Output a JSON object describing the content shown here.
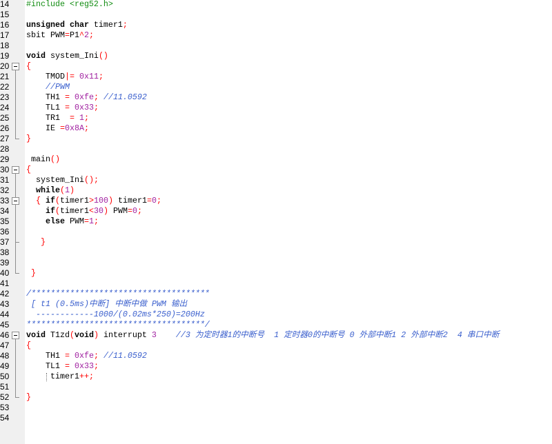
{
  "editor": {
    "syntax_colors": {
      "preprocessor": "#128c12",
      "keyword": "#000000",
      "identifier": "#000000",
      "operator": "#ff0000",
      "number": "#a020a0",
      "comment": "#3a5fcd"
    },
    "lines": [
      {
        "n": 14,
        "tokens": [
          [
            "preprocessor",
            "#include <reg52.h>"
          ]
        ]
      },
      {
        "n": 15,
        "tokens": []
      },
      {
        "n": 16,
        "tokens": [
          [
            "keyword",
            "unsigned char"
          ],
          [
            "identifier",
            " timer1"
          ],
          [
            "operator",
            ";"
          ]
        ]
      },
      {
        "n": 17,
        "tokens": [
          [
            "identifier",
            "sbit PWM"
          ],
          [
            "operator",
            "="
          ],
          [
            "identifier",
            "P1"
          ],
          [
            "operator",
            "^"
          ],
          [
            "number",
            "2"
          ],
          [
            "operator",
            ";"
          ]
        ]
      },
      {
        "n": 18,
        "tokens": []
      },
      {
        "n": 19,
        "tokens": [
          [
            "keyword",
            "void"
          ],
          [
            "identifier",
            " system_Ini"
          ],
          [
            "operator",
            "()"
          ]
        ]
      },
      {
        "n": 20,
        "fold": "fold-collapse-icon",
        "tokens": [
          [
            "operator",
            "{"
          ]
        ]
      },
      {
        "n": 21,
        "fold": "fold-guide-line",
        "tokens": [
          [
            "identifier",
            "    TMOD"
          ],
          [
            "operator",
            "|="
          ],
          [
            "number",
            " 0x11"
          ],
          [
            "operator",
            ";"
          ]
        ]
      },
      {
        "n": 22,
        "fold": "fold-guide-line",
        "tokens": [
          [
            "comment",
            "    //PWM"
          ]
        ]
      },
      {
        "n": 23,
        "fold": "fold-guide-line",
        "tokens": [
          [
            "identifier",
            "    TH1 "
          ],
          [
            "operator",
            "="
          ],
          [
            "number",
            " 0xfe"
          ],
          [
            "operator",
            ";"
          ],
          [
            "comment",
            " //11.0592"
          ]
        ]
      },
      {
        "n": 24,
        "fold": "fold-guide-line",
        "tokens": [
          [
            "identifier",
            "    TL1 "
          ],
          [
            "operator",
            "="
          ],
          [
            "number",
            " 0x33"
          ],
          [
            "operator",
            ";"
          ]
        ]
      },
      {
        "n": 25,
        "fold": "fold-guide-line",
        "tokens": [
          [
            "identifier",
            "    TR1  "
          ],
          [
            "operator",
            "="
          ],
          [
            "number",
            " 1"
          ],
          [
            "operator",
            ";"
          ]
        ]
      },
      {
        "n": 26,
        "fold": "fold-guide-line",
        "tokens": [
          [
            "identifier",
            "    IE "
          ],
          [
            "operator",
            "="
          ],
          [
            "number",
            "0x8A"
          ],
          [
            "operator",
            ";"
          ]
        ]
      },
      {
        "n": 27,
        "fold": "fold-end-icon",
        "tokens": [
          [
            "operator",
            "}"
          ]
        ]
      },
      {
        "n": 28,
        "tokens": []
      },
      {
        "n": 29,
        "tokens": [
          [
            "identifier",
            " main"
          ],
          [
            "operator",
            "()"
          ]
        ]
      },
      {
        "n": 30,
        "fold": "fold-collapse-icon",
        "tokens": [
          [
            "operator",
            "{"
          ]
        ]
      },
      {
        "n": 31,
        "fold": "fold-guide-line",
        "tokens": [
          [
            "identifier",
            "  system_Ini"
          ],
          [
            "operator",
            "();"
          ]
        ]
      },
      {
        "n": 32,
        "fold": "fold-guide-line",
        "tokens": [
          [
            "keyword",
            "  while"
          ],
          [
            "operator",
            "("
          ],
          [
            "number",
            "1"
          ],
          [
            "operator",
            ")"
          ]
        ]
      },
      {
        "n": 33,
        "fold": "fold-collapse-nested-icon",
        "tokens": [
          [
            "operator",
            "  {"
          ],
          [
            "keyword",
            " if"
          ],
          [
            "operator",
            "("
          ],
          [
            "identifier",
            "timer1"
          ],
          [
            "operator",
            ">"
          ],
          [
            "number",
            "100"
          ],
          [
            "operator",
            ")"
          ],
          [
            "identifier",
            " timer1"
          ],
          [
            "operator",
            "="
          ],
          [
            "number",
            "0"
          ],
          [
            "operator",
            ";"
          ]
        ]
      },
      {
        "n": 34,
        "fold": "fold-guide-line",
        "tokens": [
          [
            "keyword",
            "    if"
          ],
          [
            "operator",
            "("
          ],
          [
            "identifier",
            "timer1"
          ],
          [
            "operator",
            "<"
          ],
          [
            "number",
            "30"
          ],
          [
            "operator",
            ")"
          ],
          [
            "identifier",
            " PWM"
          ],
          [
            "operator",
            "="
          ],
          [
            "number",
            "0"
          ],
          [
            "operator",
            ";"
          ]
        ]
      },
      {
        "n": 35,
        "fold": "fold-guide-line",
        "tokens": [
          [
            "keyword",
            "    else"
          ],
          [
            "identifier",
            " PWM"
          ],
          [
            "operator",
            "="
          ],
          [
            "number",
            "1"
          ],
          [
            "operator",
            ";"
          ]
        ]
      },
      {
        "n": 36,
        "fold": "fold-guide-line",
        "tokens": []
      },
      {
        "n": 37,
        "fold": "fold-branch-end-icon",
        "tokens": [
          [
            "operator",
            "   }"
          ]
        ]
      },
      {
        "n": 38,
        "fold": "fold-guide-line",
        "tokens": []
      },
      {
        "n": 39,
        "fold": "fold-guide-line",
        "tokens": []
      },
      {
        "n": 40,
        "fold": "fold-end-icon",
        "tokens": [
          [
            "operator",
            " }"
          ]
        ]
      },
      {
        "n": 41,
        "tokens": []
      },
      {
        "n": 42,
        "tokens": [
          [
            "comment",
            "/*************************************"
          ]
        ]
      },
      {
        "n": 43,
        "tokens": [
          [
            "comment",
            " [ t1 (0.5ms)中断] 中断中做 PWM 输出"
          ]
        ]
      },
      {
        "n": 44,
        "tokens": [
          [
            "comment",
            "  ------------1000/(0.02ms*250)=200Hz"
          ]
        ]
      },
      {
        "n": 45,
        "tokens": [
          [
            "comment",
            "*************************************/"
          ]
        ]
      },
      {
        "n": 46,
        "fold": "fold-collapse-icon",
        "tokens": [
          [
            "keyword",
            "void"
          ],
          [
            "identifier",
            " T1zd"
          ],
          [
            "operator",
            "("
          ],
          [
            "keyword",
            "void"
          ],
          [
            "operator",
            ")"
          ],
          [
            "identifier",
            " interrupt"
          ],
          [
            "number",
            " 3"
          ],
          [
            "comment",
            "    //3 为定时器1的中断号  1 定时器0的中断号 0 外部中断1 2 外部中断2  4 串口中断"
          ]
        ]
      },
      {
        "n": 47,
        "fold": "fold-guide-line",
        "tokens": [
          [
            "operator",
            "{"
          ]
        ]
      },
      {
        "n": 48,
        "fold": "fold-guide-line",
        "tokens": [
          [
            "identifier",
            "    TH1 "
          ],
          [
            "operator",
            "="
          ],
          [
            "number",
            " 0xfe"
          ],
          [
            "operator",
            ";"
          ],
          [
            "comment",
            " //11.0592"
          ]
        ]
      },
      {
        "n": 49,
        "fold": "fold-guide-line",
        "tokens": [
          [
            "identifier",
            "    TL1 "
          ],
          [
            "operator",
            "="
          ],
          [
            "number",
            " 0x33"
          ],
          [
            "operator",
            ";"
          ]
        ]
      },
      {
        "n": 50,
        "fold": "fold-guide-line",
        "tokens": [
          [
            "identifier",
            "     timer1"
          ],
          [
            "operator",
            "++;"
          ]
        ]
      },
      {
        "n": 51,
        "fold": "fold-guide-line",
        "tokens": []
      },
      {
        "n": 52,
        "fold": "fold-end-icon",
        "tokens": [
          [
            "operator",
            "}"
          ]
        ]
      },
      {
        "n": 53,
        "tokens": []
      },
      {
        "n": 54,
        "tokens": []
      }
    ]
  }
}
